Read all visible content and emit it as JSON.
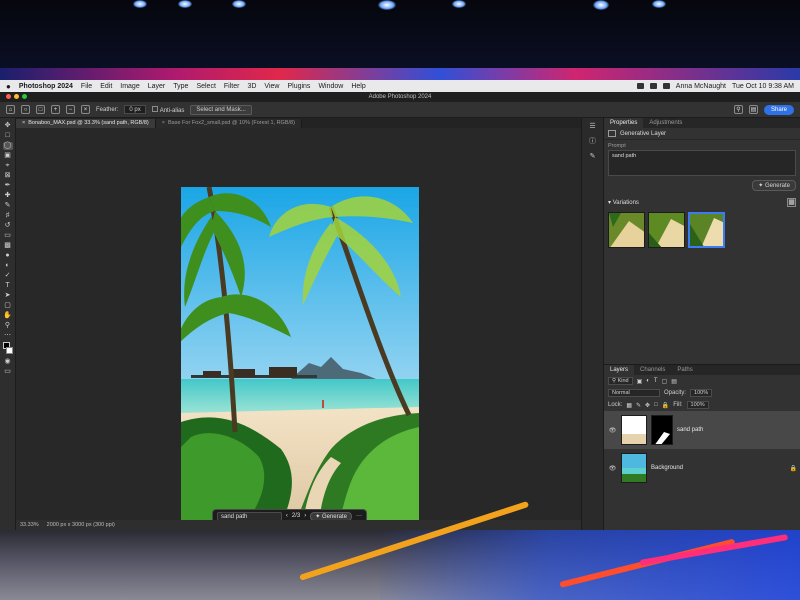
{
  "os_menubar": {
    "apple": "",
    "app_name": "Photoshop 2024",
    "menus": [
      "File",
      "Edit",
      "Image",
      "Layer",
      "Type",
      "Select",
      "Filter",
      "3D",
      "View",
      "Plugins",
      "Window",
      "Help"
    ],
    "user": "Anna McNaught",
    "datetime": "Tue Oct 10  9:38 AM"
  },
  "window": {
    "title": "Adobe Photoshop 2024"
  },
  "options_bar": {
    "feather_label": "Feather:",
    "feather_value": "0 px",
    "anti_alias_label": "Anti-alias",
    "select_mask_label": "Select and Mask...",
    "share_label": "Share"
  },
  "doc_tabs": [
    {
      "label": "Bonaboo_MAX.psd @ 33.3% (sand path, RGB/8)",
      "active": true
    },
    {
      "label": "Base For Fox2_small.psd @ 10% (Forest 1, RGB/8)",
      "active": false
    }
  ],
  "contextual_bar": {
    "prompt": "sand path",
    "variation_counter": "2/3",
    "generate_label": "Generate",
    "more": "···"
  },
  "status_bar": {
    "zoom": "33.33%",
    "doc_size": "2000 px x 3000 px (300 ppi)"
  },
  "properties_panel": {
    "tabs": [
      "Properties",
      "Adjustments"
    ],
    "layer_type": "Generative Layer",
    "prompt_label": "Prompt",
    "prompt_value": "sand path",
    "generate_label": "Generate",
    "variations_label": "Variations",
    "variations": [
      "variation-1",
      "variation-2",
      "variation-3"
    ],
    "selected_variation": 3
  },
  "layers_panel": {
    "tabs": [
      "Layers",
      "Channels",
      "Paths"
    ],
    "filter_kind": "Kind",
    "blend_mode": "Normal",
    "opacity_label": "Opacity:",
    "opacity_value": "100%",
    "lock_label": "Lock:",
    "fill_label": "Fill:",
    "fill_value": "100%",
    "layers": [
      {
        "name": "sand path",
        "selected": true
      },
      {
        "name": "Background",
        "selected": false
      }
    ]
  },
  "colors": {
    "accent_blue": "#2f72e8",
    "selection_blue": "#3d7cf0",
    "panel_bg": "#323232",
    "canvas_bg": "#282828"
  }
}
